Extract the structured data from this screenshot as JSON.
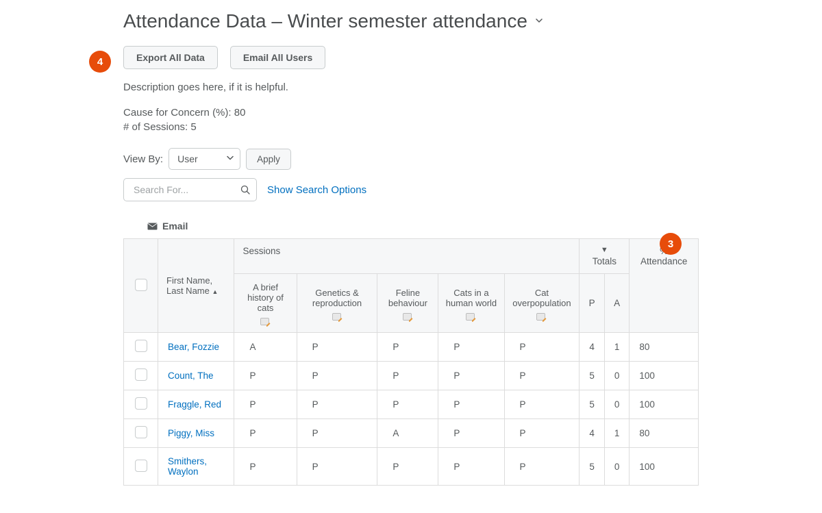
{
  "page_title": "Attendance Data – Winter semester attendance",
  "toolbar": {
    "export_label": "Export All Data",
    "email_all_label": "Email All Users"
  },
  "description": "Description goes here, if it is helpful.",
  "meta": {
    "concern_label": "Cause for Concern (%): 80",
    "sessions_label": "# of Sessions: 5"
  },
  "view_by": {
    "label": "View By:",
    "selected": "User",
    "apply_label": "Apply"
  },
  "search": {
    "placeholder": "Search For...",
    "options_link": "Show Search Options"
  },
  "email_action": "Email",
  "annotations": {
    "a3": "3",
    "a4": "4"
  },
  "table": {
    "sessions_header": "Sessions",
    "totals_header": "Totals",
    "pct_header": "% Attendance",
    "name_header_1": "First Name,",
    "name_header_2": "Last Name",
    "p_header": "P",
    "a_header": "A",
    "sessions": [
      "A brief history of cats",
      "Genetics & reproduction",
      "Feline behaviour",
      "Cats in a human world",
      "Cat overpopulation"
    ],
    "rows": [
      {
        "name": "Bear, Fozzie",
        "marks": [
          "A",
          "P",
          "P",
          "P",
          "P"
        ],
        "p": "4",
        "a": "1",
        "pct": "80"
      },
      {
        "name": "Count, The",
        "marks": [
          "P",
          "P",
          "P",
          "P",
          "P"
        ],
        "p": "5",
        "a": "0",
        "pct": "100"
      },
      {
        "name": "Fraggle, Red",
        "marks": [
          "P",
          "P",
          "P",
          "P",
          "P"
        ],
        "p": "5",
        "a": "0",
        "pct": "100"
      },
      {
        "name": "Piggy, Miss",
        "marks": [
          "P",
          "P",
          "A",
          "P",
          "P"
        ],
        "p": "4",
        "a": "1",
        "pct": "80"
      },
      {
        "name": "Smithers, Waylon",
        "marks": [
          "P",
          "P",
          "P",
          "P",
          "P"
        ],
        "p": "5",
        "a": "0",
        "pct": "100"
      }
    ]
  }
}
